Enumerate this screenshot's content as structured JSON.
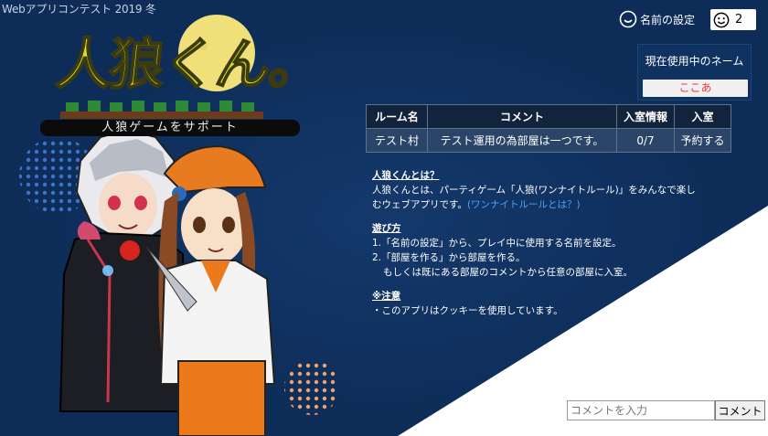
{
  "contest_label": "Webアプリコンテスト 2019 冬",
  "logo": {
    "title": "人狼くん。",
    "tagline": "人狼ゲームをサポート"
  },
  "header": {
    "settings_label": "名前の設定",
    "online_count": "2"
  },
  "name_panel": {
    "label": "現在使用中のネーム",
    "current_name": "ここあ"
  },
  "rooms": {
    "headers": [
      "ルーム名",
      "コメント",
      "入室情報",
      "入室"
    ],
    "rows": [
      {
        "name": "テスト村",
        "comment": "テスト運用の為部屋は一つです。",
        "occupancy": "0/7",
        "action": "予約する"
      }
    ]
  },
  "info": {
    "about_heading": "人狼くんとは？",
    "about_line1": "人狼くんとは、パーティゲーム「人狼(ワンナイトルール)」をみんなで楽し",
    "about_line2": "むウェブアプリです。",
    "about_link": "(ワンナイトルールとは？)",
    "howto_heading": "遊び方",
    "howto_1": "1.「名前の設定」から、プレイ中に使用する名前を設定。",
    "howto_2": "2.「部屋を作る」から部屋を作る。",
    "howto_3": "もしくは既にある部屋のコメントから任意の部屋に入室。",
    "notice_heading": "※注意",
    "notice_1": "・このアプリはクッキーを使用しています。"
  },
  "comment_bar": {
    "placeholder": "コメントを入力",
    "button_label": "コメント"
  },
  "colors": {
    "background_navy": "#0d2c57",
    "moon_yellow": "#efe07a",
    "logo_yellow": "#d7e21a",
    "name_red": "#e83a3a",
    "link_blue": "#4aa4ff",
    "table_header": "#12233c",
    "table_cell": "#2a4568"
  }
}
